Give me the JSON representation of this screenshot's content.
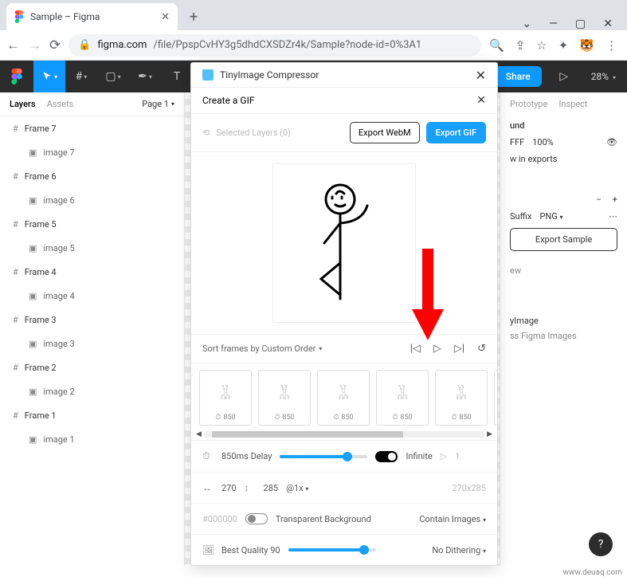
{
  "browser": {
    "tab_title": "Sample – Figma",
    "url_host": "figma.com",
    "url_path": "/file/PpspCvHY3g5dhdCXSDZr4k/Sample?node-id=0%3A1"
  },
  "figma": {
    "share": "Share",
    "zoom": "28%"
  },
  "leftpanel": {
    "tab_layers": "Layers",
    "tab_assets": "Assets",
    "page_label": "Page 1",
    "layers": [
      {
        "frame": "Frame 7",
        "image": "image 7"
      },
      {
        "frame": "Frame 6",
        "image": "image 6"
      },
      {
        "frame": "Frame 5",
        "image": "image 5"
      },
      {
        "frame": "Frame 4",
        "image": "image 4"
      },
      {
        "frame": "Frame 3",
        "image": "image 3"
      },
      {
        "frame": "Frame 2",
        "image": "image 2"
      },
      {
        "frame": "Frame 1",
        "image": "image 1"
      }
    ]
  },
  "rightpanel": {
    "tab_prototype": "Prototype",
    "tab_inspect": "Inspect",
    "background_heading": "und",
    "color": "FFF",
    "opacity": "100%",
    "show_exports": "w in exports",
    "suffix": "Suffix",
    "format": "PNG",
    "export_btn": "Export Sample",
    "preview_label": "ew",
    "plugin_name": "yImage",
    "plugin_desc": "ss Figma Images"
  },
  "plugin": {
    "title": "TinyImage Compressor",
    "subtitle": "Create a GIF",
    "selected_layers": "Selected Layers (0)",
    "export_webm": "Export WebM",
    "export_gif": "Export GIF",
    "sort_label": "Sort frames by Custom Order",
    "thumb_ms": "850",
    "delay_label": "850ms Delay",
    "infinite": "Infinite",
    "loop_count": "1",
    "width": "270",
    "height": "285",
    "scale": "@1x",
    "dims_text": "270x285",
    "bg_color": "#000000",
    "transparent_bg": "Transparent Background",
    "contain_images": "Contain Images",
    "quality_label": "Best Quality 90",
    "dithering": "No Dithering"
  },
  "watermark": "www.deuaq.com"
}
